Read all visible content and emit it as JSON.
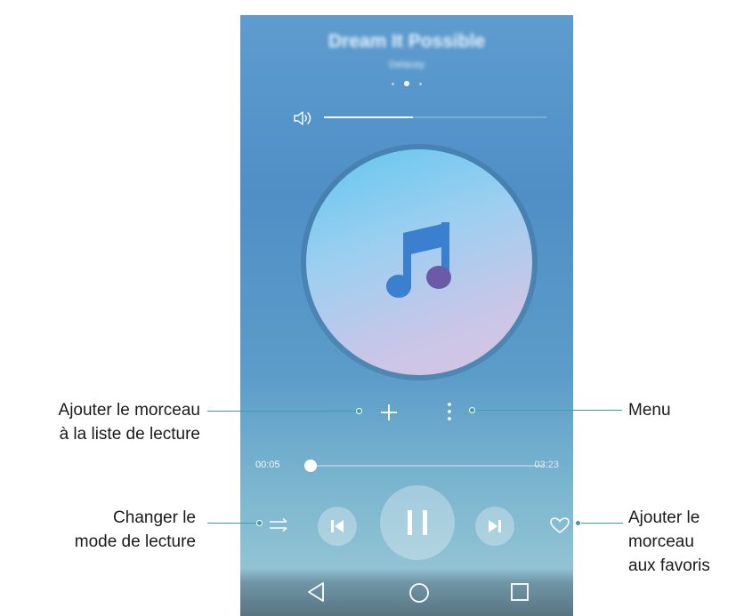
{
  "player": {
    "song_title": "Dream It Possible",
    "artist": "Delacey",
    "page_indicator": {
      "count": 3,
      "active": 2
    },
    "volume_level": 0.4,
    "time_current": "00:05",
    "time_total": "03:23",
    "progress": 0.025
  },
  "icons": {
    "volume": "speaker-icon",
    "album_art": "music-note-icon",
    "add": "plus-icon",
    "menu": "vertical-dots-icon",
    "play_mode": "repeat-arrows-icon",
    "previous": "skip-previous-icon",
    "pause": "pause-icon",
    "next": "skip-next-icon",
    "favorite": "heart-icon",
    "nav_back": "triangle-back-icon",
    "nav_home": "circle-home-icon",
    "nav_recent": "square-recent-icon"
  },
  "annotations": {
    "add_line1": "Ajouter le morceau",
    "add_line2": "à la liste de lecture",
    "menu": "Menu",
    "mode_line1": "Changer le",
    "mode_line2": "mode de lecture",
    "fav_line1": "Ajouter le",
    "fav_line2": "morceau",
    "fav_line3": "aux favoris"
  },
  "colors": {
    "accent_leader": "#3aa0a8",
    "note_blue": "#3b7fcf",
    "note_purple": "#6a5aa8"
  }
}
